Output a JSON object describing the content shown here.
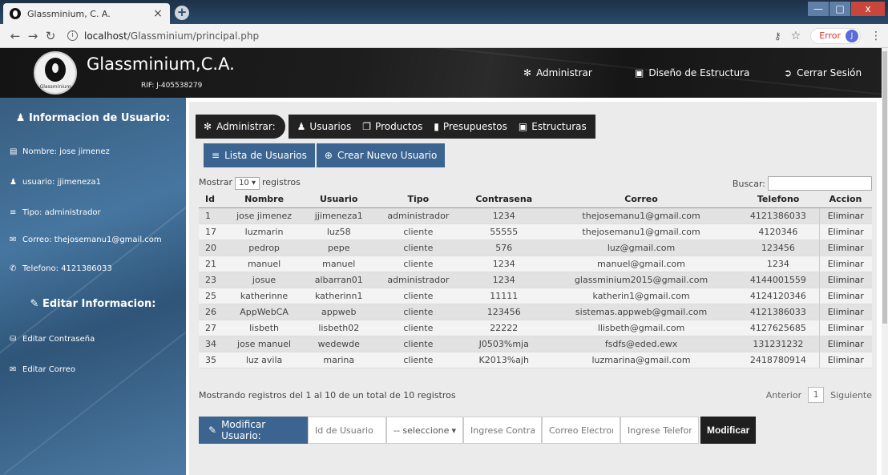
{
  "browser": {
    "tab_title": "Glassminium, C. A.",
    "tab_close": "×",
    "new_tab": "+",
    "url_host": "localhost",
    "url_path": "/Glassminium/principal.php",
    "error_label": "Error",
    "avatar_letter": "J",
    "win_min": "—",
    "win_max": "□",
    "win_close": "x"
  },
  "header": {
    "brand": "Glassminium,C.A.",
    "rif": "RIF: J-405538279",
    "logo_caption": "Glassminium",
    "nav": [
      {
        "label": "Administrar",
        "icon": "gear-icon"
      },
      {
        "label": "Diseño de Estructura",
        "icon": "furniture-icon"
      },
      {
        "label": "Cerrar Sesión",
        "icon": "logout-icon"
      }
    ]
  },
  "sidebar": {
    "info_heading": "Informacion de Usuario:",
    "items": [
      {
        "label": "Nombre: jose jimenez",
        "icon": "id-card-icon"
      },
      {
        "label": "usuario: jjimeneza1",
        "icon": "user-icon"
      },
      {
        "label": "Tipo: administrador",
        "icon": "list-icon"
      },
      {
        "label": "Correo: thejosemanu1@gmail.com",
        "icon": "envelope-icon"
      },
      {
        "label": "Telefono: 4121386033",
        "icon": "phone-icon"
      }
    ],
    "edit_heading": "Editar Informacion:",
    "edit_items": [
      {
        "label": "Editar Contraseña",
        "icon": "lock-icon"
      },
      {
        "label": "Editar Correo",
        "icon": "envelope-icon"
      }
    ]
  },
  "admin_tabs": {
    "lead": "Administrar:",
    "items": [
      {
        "label": "Usuarios",
        "icon": "user-icon"
      },
      {
        "label": "Productos",
        "icon": "products-icon"
      },
      {
        "label": "Presupuestos",
        "icon": "document-icon"
      },
      {
        "label": "Estructuras",
        "icon": "furniture-icon"
      }
    ]
  },
  "sub_tabs": [
    {
      "label": "Lista de Usuarios",
      "icon": "list-icon"
    },
    {
      "label": "Crear Nuevo Usuario",
      "icon": "plus-circle-icon"
    }
  ],
  "table_controls": {
    "show_prefix": "Mostrar",
    "show_value": "10",
    "show_suffix": "registros",
    "search_label": "Buscar:",
    "search_value": ""
  },
  "table": {
    "columns": [
      "Id",
      "Nombre",
      "Usuario",
      "Tipo",
      "Contrasena",
      "Correo",
      "Telefono",
      "Accion"
    ],
    "rows": [
      [
        "1",
        "jose jimenez",
        "jjimeneza1",
        "administrador",
        "1234",
        "thejosemanu1@gmail.com",
        "4121386033",
        "Eliminar"
      ],
      [
        "17",
        "luzmarin",
        "luz58",
        "cliente",
        "55555",
        "thejosemanu1@gmail.com",
        "4120346",
        "Eliminar"
      ],
      [
        "20",
        "pedrop",
        "pepe",
        "cliente",
        "576",
        "luz@gmail.com",
        "123456",
        "Eliminar"
      ],
      [
        "21",
        "manuel",
        "manuel",
        "cliente",
        "1234",
        "manuel@gmail.com",
        "1234",
        "Eliminar"
      ],
      [
        "23",
        "josue",
        "albarran01",
        "administrador",
        "1234",
        "glassminium2015@gmail.com",
        "4144001559",
        "Eliminar"
      ],
      [
        "25",
        "katherinne",
        "katherinn1",
        "cliente",
        "11111",
        "katherin1@gmail.com",
        "4124120346",
        "Eliminar"
      ],
      [
        "26",
        "AppWebCA",
        "appweb",
        "cliente",
        "123456",
        "sistemas.appweb@gmail.com",
        "4121386033",
        "Eliminar"
      ],
      [
        "27",
        "lisbeth",
        "lisbeth02",
        "cliente",
        "22222",
        "llisbeth@gmail.com",
        "4127625685",
        "Eliminar"
      ],
      [
        "34",
        "jose manuel",
        "wedewde",
        "cliente",
        "J0503%mja",
        "fsdfs@eded.ewx",
        "131231232",
        "Eliminar"
      ],
      [
        "35",
        "luz avila",
        "marina",
        "cliente",
        "K2013%ajh",
        "luzmarina@gmail.com",
        "2418780914",
        "Eliminar"
      ]
    ]
  },
  "table_footer": {
    "info": "Mostrando registros del 1 al 10 de un total de 10 registros",
    "prev": "Anterior",
    "page": "1",
    "next": "Siguiente"
  },
  "modify_form": {
    "lead": "Modificar Usuario:",
    "id_placeholder": "Id de Usuario",
    "select_value": "-- seleccione",
    "password_placeholder": "Ingrese Contraseña",
    "email_placeholder": "Correo Electronico",
    "phone_placeholder": "Ingrese Telefono",
    "submit": "Modificar"
  },
  "colors": {
    "primary": "#3b6590",
    "dark": "#222222",
    "sidebar": "#3f6b8f"
  }
}
